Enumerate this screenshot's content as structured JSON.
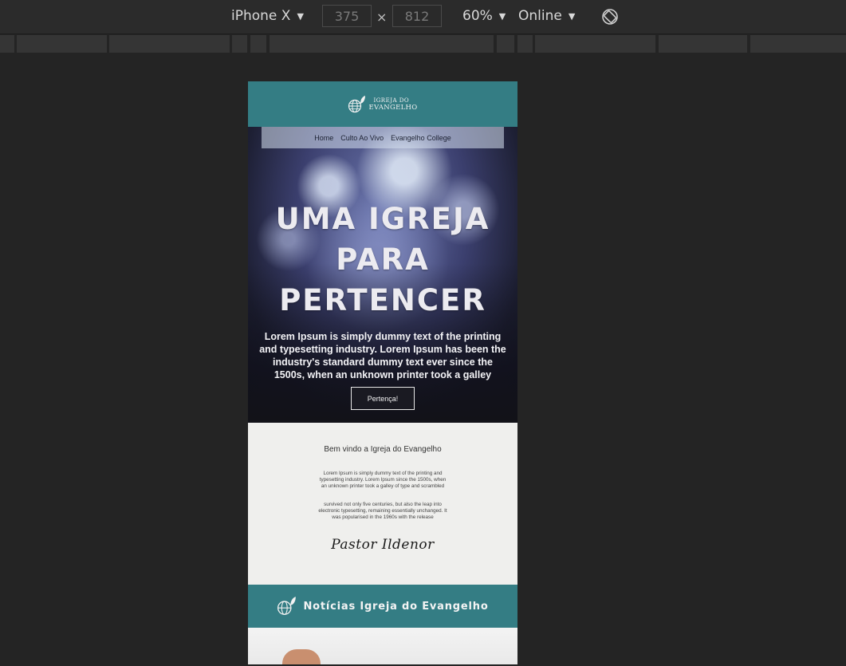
{
  "devtools": {
    "device_name": "iPhone X",
    "width_value": "375",
    "height_value": "812",
    "times_symbol": "×",
    "zoom": "60%",
    "throttling": "Online",
    "caret": "▼"
  },
  "site": {
    "logo_top": "IGREJA DO",
    "logo_bottom": "EVANGELHO",
    "nav": [
      "Home",
      "Culto Ao Vivo",
      "Evangelho College"
    ],
    "hero_title_lines": [
      "UMA IGREJA",
      "PARA",
      "PERTENCER"
    ],
    "hero_text": "Lorem Ipsum is simply dummy text of the printing and typesetting industry. Lorem Ipsum has been the industry's standard dummy text ever since the 1500s, when an unknown printer took a galley",
    "hero_button": "Pertença!",
    "welcome_title": "Bem vindo a Igreja do Evangelho",
    "welcome_p1": "Lorem Ipsum is simply dummy text of the printing and typesetting industry. Lorem Ipsum since the 1500s, when an unknown printer took a galley of type and scrambled",
    "welcome_p2": "survived not only five centuries, but also the leap into electronic typesetting, remaining essentially unchanged. It was popularised in the 1960s with the release",
    "signature": "Pastor Ildenor",
    "news_title": "Notícias Igreja do Evangelho"
  },
  "colors": {
    "teal": "#347d84",
    "devtools_bg": "#242424"
  },
  "icons": {
    "rotate": "rotate-icon",
    "logo": "globe-leaf-icon"
  }
}
